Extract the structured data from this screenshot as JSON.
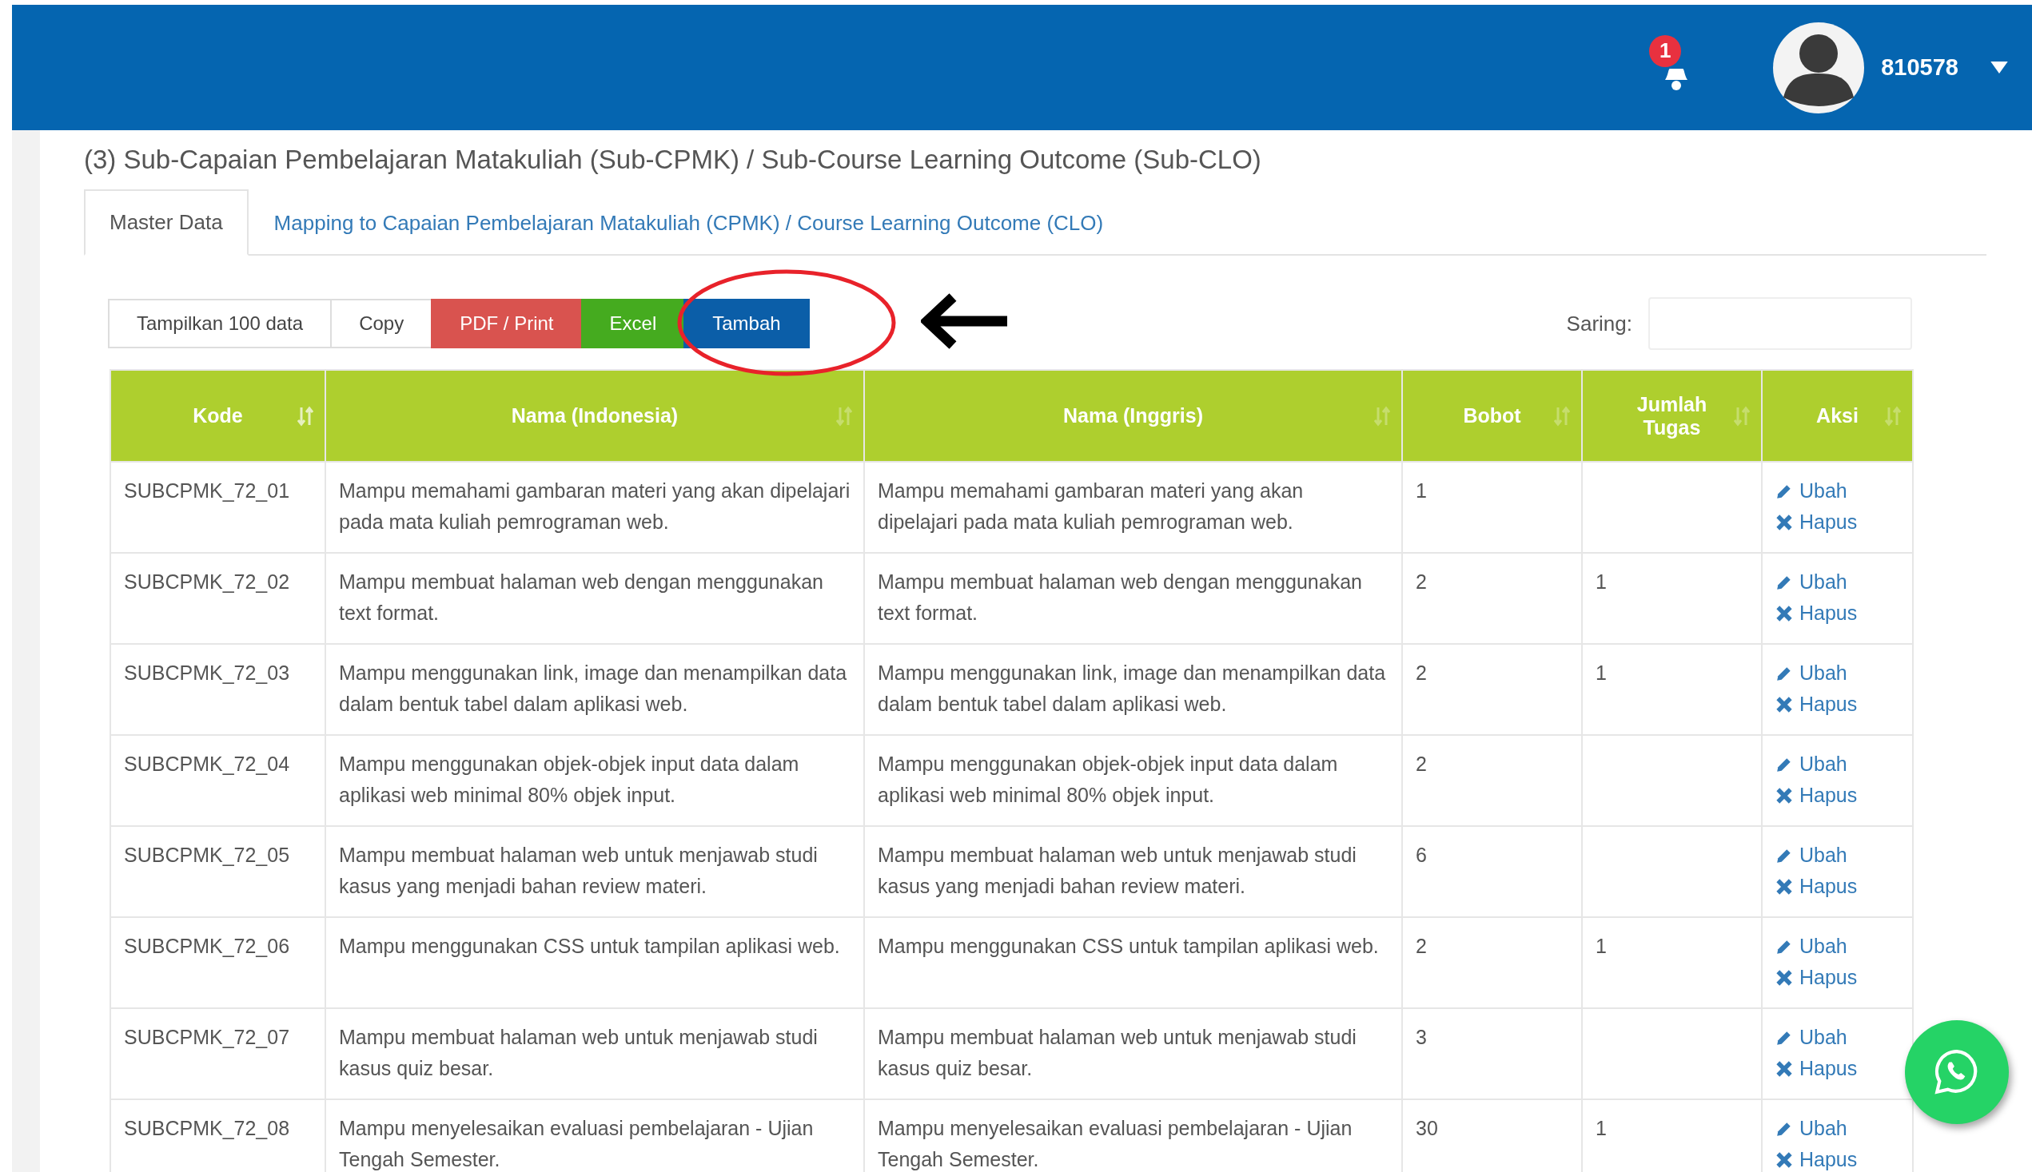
{
  "header": {
    "notification_count": "1",
    "username": "810578"
  },
  "title": "(3) Sub-Capaian Pembelajaran Matakuliah (Sub-CPMK) / Sub-Course Learning Outcome (Sub-CLO)",
  "tabs": [
    {
      "label": "Master Data",
      "selected": true
    },
    {
      "label": "Mapping to Capaian Pembelajaran Matakuliah (CPMK) / Course Learning Outcome (CLO)",
      "selected": false
    }
  ],
  "toolbar": {
    "buttons": [
      {
        "label": "Tampilkan 100 data",
        "kind": "default"
      },
      {
        "label": "Copy",
        "kind": "default"
      },
      {
        "label": "PDF / Print",
        "kind": "danger"
      },
      {
        "label": "Excel",
        "kind": "success"
      },
      {
        "label": "Tambah",
        "kind": "primary"
      }
    ],
    "filter_label": "Saring:"
  },
  "table": {
    "columns": [
      {
        "label": "Kode",
        "sorted": true
      },
      {
        "label": "Nama (Indonesia)",
        "sorted": false
      },
      {
        "label": "Nama (Inggris)",
        "sorted": false
      },
      {
        "label": "Bobot",
        "sorted": false
      },
      {
        "label": "Jumlah Tugas",
        "sorted": false
      },
      {
        "label": "Aksi",
        "sorted": false
      }
    ],
    "rows": [
      {
        "cells": [
          "SUBCPMK_72_01",
          "Mampu memahami gambaran materi yang akan dipelajari pada mata kuliah pemrograman web.",
          "Mampu memahami gambaran materi yang akan dipelajari pada mata kuliah pemrograman web.",
          "1",
          ""
        ],
        "actions": [
          {
            "kind": "edit",
            "label": "Ubah"
          },
          {
            "kind": "delete",
            "label": "Hapus"
          }
        ]
      },
      {
        "cells": [
          "SUBCPMK_72_02",
          "Mampu membuat halaman web dengan menggunakan text format.",
          "Mampu membuat halaman web dengan menggunakan text format.",
          "2",
          "1"
        ],
        "actions": [
          {
            "kind": "edit",
            "label": "Ubah"
          },
          {
            "kind": "delete",
            "label": "Hapus"
          }
        ]
      },
      {
        "cells": [
          "SUBCPMK_72_03",
          "Mampu menggunakan link, image dan menampilkan data dalam bentuk tabel dalam aplikasi web.",
          "Mampu menggunakan link, image dan menampilkan data dalam bentuk tabel dalam aplikasi web.",
          "2",
          "1"
        ],
        "actions": [
          {
            "kind": "edit",
            "label": "Ubah"
          },
          {
            "kind": "delete",
            "label": "Hapus"
          }
        ]
      },
      {
        "cells": [
          "SUBCPMK_72_04",
          "Mampu menggunakan objek-objek input data dalam aplikasi web minimal 80% objek input.",
          "Mampu menggunakan objek-objek input data dalam aplikasi web minimal 80% objek input.",
          "2",
          ""
        ],
        "actions": [
          {
            "kind": "edit",
            "label": "Ubah"
          },
          {
            "kind": "delete",
            "label": "Hapus"
          }
        ]
      },
      {
        "cells": [
          "SUBCPMK_72_05",
          "Mampu membuat halaman web untuk menjawab studi kasus yang menjadi bahan review materi.",
          "Mampu membuat halaman web untuk menjawab studi kasus yang menjadi bahan review materi.",
          "6",
          ""
        ],
        "actions": [
          {
            "kind": "edit",
            "label": "Ubah"
          },
          {
            "kind": "delete",
            "label": "Hapus"
          }
        ]
      },
      {
        "cells": [
          "SUBCPMK_72_06",
          "Mampu menggunakan CSS untuk tampilan aplikasi web.",
          "Mampu menggunakan CSS untuk tampilan aplikasi web.",
          "2",
          "1"
        ],
        "actions": [
          {
            "kind": "edit",
            "label": "Ubah"
          },
          {
            "kind": "delete",
            "label": "Hapus"
          }
        ]
      },
      {
        "cells": [
          "SUBCPMK_72_07",
          "Mampu membuat halaman web untuk menjawab studi kasus quiz besar.",
          "Mampu membuat halaman web untuk menjawab studi kasus quiz besar.",
          "3",
          ""
        ],
        "actions": [
          {
            "kind": "edit",
            "label": "Ubah"
          },
          {
            "kind": "delete",
            "label": "Hapus"
          }
        ]
      },
      {
        "cells": [
          "SUBCPMK_72_08",
          "Mampu menyelesaikan evaluasi pembelajaran - Ujian Tengah Semester.",
          "Mampu menyelesaikan evaluasi pembelajaran - Ujian Tengah Semester.",
          "30",
          "1"
        ],
        "actions": [
          {
            "kind": "edit",
            "label": "Ubah"
          },
          {
            "kind": "delete",
            "label": "Hapus"
          }
        ]
      }
    ]
  }
}
